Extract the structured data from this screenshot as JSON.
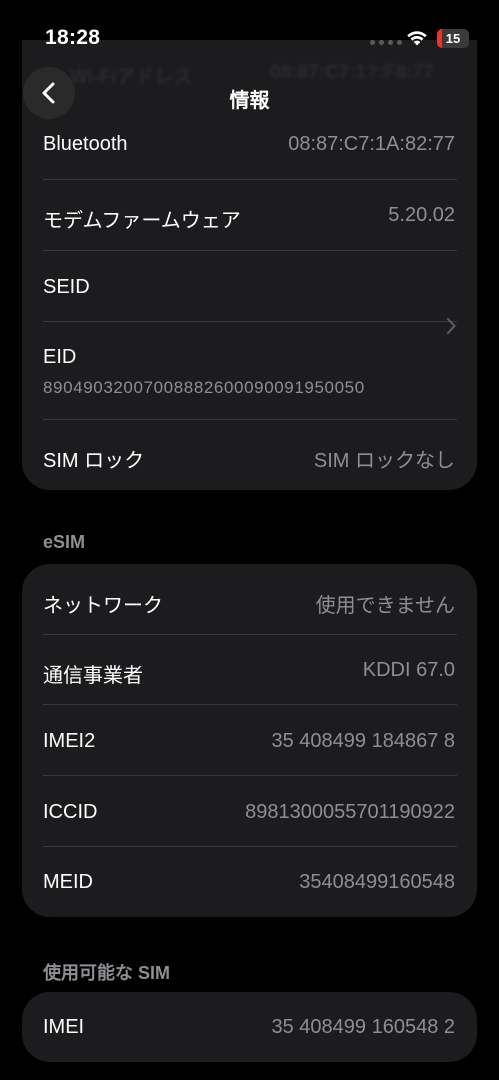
{
  "status_bar": {
    "time": "18:28",
    "battery_level": "15",
    "battery_fraction": 0.15,
    "accent_color": "#e5352f"
  },
  "header_ghost": {
    "left": "Wi-Fiアドレス",
    "right": "08:87:C7:1?:F8:77"
  },
  "nav": {
    "title": "情報",
    "back_icon": "chevron-left-icon"
  },
  "about_rows": {
    "bluetooth": {
      "label": "Bluetooth",
      "value": "08:87:C7:1A:82:77"
    },
    "modem": {
      "label": "モデムファームウェア",
      "value": "5.20.02"
    },
    "seid": {
      "label": "SEID",
      "icon": "chevron-right-icon"
    },
    "eid": {
      "label": "EID",
      "value": "89049032007008882600090091950050"
    },
    "sim_lock": {
      "label": "SIM ロック",
      "value": "SIM ロックなし"
    }
  },
  "esim": {
    "header": "eSIM",
    "network": {
      "label": "ネットワーク",
      "value": "使用できません"
    },
    "carrier": {
      "label": "通信事業者",
      "value": "KDDI 67.0"
    },
    "imei2": {
      "label": "IMEI2",
      "value": "35 408499 184867 8"
    },
    "iccid": {
      "label": "ICCID",
      "value": "8981300055701190922"
    },
    "meid": {
      "label": "MEID",
      "value": "35408499160548"
    }
  },
  "available_sim": {
    "header": "使用可能な SIM",
    "imei": {
      "label": "IMEI",
      "value": "35 408499 160548 2"
    }
  }
}
